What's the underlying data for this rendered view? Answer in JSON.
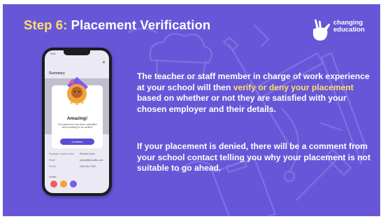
{
  "slide": {
    "title_step": "Step 6:",
    "title_text": "Placement Verification",
    "logo": {
      "line1": "changing",
      "line2": "education",
      "icon": "hand-gesture-icon"
    },
    "para1": {
      "part1": "The teacher or staff member in charge of work experience at your school will then ",
      "highlight": "verify or deny your placement",
      "part2": " based on whether or not they are satisfied with your chosen employer and their details."
    },
    "para2": "If your placement is denied, there will be a comment from your school contact telling you why your placement is not suitable to go ahead.",
    "colors": {
      "background": "#6757d8",
      "highlight": "#ffe066",
      "text": "#ffffff"
    }
  },
  "phone": {
    "status_time": "9:41",
    "header": "Summary",
    "modal": {
      "title": "Amazing!",
      "text": "The placement has been submitted and is waiting to be verified",
      "button": "Continue"
    },
    "details": [
      {
        "label": "Employer contact name",
        "value": "Richard Jones"
      },
      {
        "label": "Email",
        "value": "jones@abcaudits.com"
      },
      {
        "label": "Phone",
        "value": "0161 534 7329"
      }
    ],
    "goals_label": "Goals"
  }
}
